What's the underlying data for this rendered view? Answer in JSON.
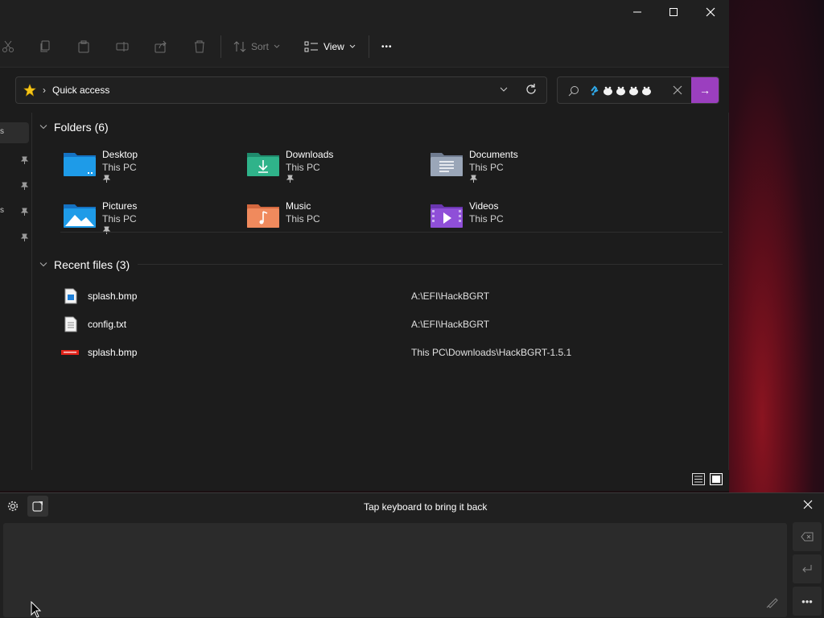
{
  "window": {
    "minimize_glyph": "—",
    "maximize_glyph": "☐",
    "close_glyph": "✕"
  },
  "toolbar": {
    "sort_label": "Sort",
    "view_label": "View",
    "more_glyph": "•••"
  },
  "address": {
    "location": "Quick access",
    "separator": "›"
  },
  "search": {
    "value": "",
    "arrow_glyph": "→"
  },
  "groups": {
    "folders_label": "Folders (6)",
    "recent_label": "Recent files (3)"
  },
  "folders": [
    {
      "name": "Desktop",
      "location": "This PC",
      "pinned": true,
      "icon": "desktop-folder-icon"
    },
    {
      "name": "Downloads",
      "location": "This PC",
      "pinned": true,
      "icon": "downloads-folder-icon"
    },
    {
      "name": "Documents",
      "location": "This PC",
      "pinned": true,
      "icon": "documents-folder-icon"
    },
    {
      "name": "Pictures",
      "location": "This PC",
      "pinned": true,
      "icon": "pictures-folder-icon"
    },
    {
      "name": "Music",
      "location": "This PC",
      "pinned": false,
      "icon": "music-folder-icon"
    },
    {
      "name": "Videos",
      "location": "This PC",
      "pinned": false,
      "icon": "videos-folder-icon"
    }
  ],
  "recent_files": [
    {
      "name": "splash.bmp",
      "path": "A:\\EFI\\HackBGRT",
      "icon": "image-file-icon"
    },
    {
      "name": "config.txt",
      "path": "A:\\EFI\\HackBGRT",
      "icon": "text-file-icon"
    },
    {
      "name": "splash.bmp",
      "path": "This PC\\Downloads\\HackBGRT-1.5.1",
      "icon": "lenovo-image-icon"
    }
  ],
  "keyboard": {
    "message": "Tap keyboard to bring it back",
    "close_glyph": "✕"
  },
  "colors": {
    "accent": "#9b3fbf",
    "folder_blue": "#1e9be8",
    "folder_green": "#2fb38a",
    "folder_gray": "#9aa6b8",
    "folder_orange": "#f08a5d",
    "folder_purple": "#8f4fd8"
  }
}
